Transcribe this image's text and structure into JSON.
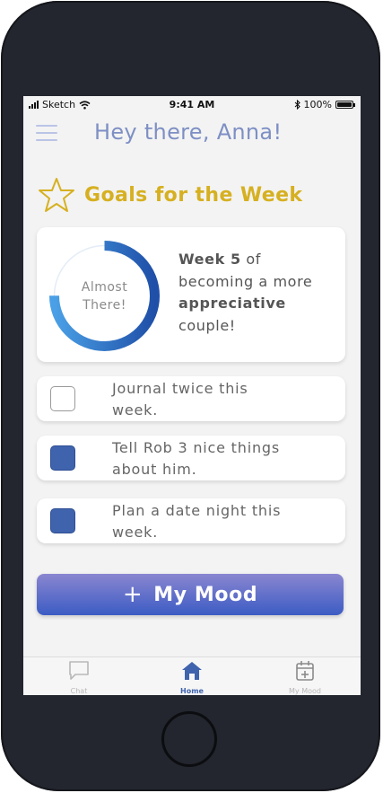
{
  "status_bar": {
    "carrier": "Sketch",
    "time": "9:41 AM",
    "battery": "100%"
  },
  "header": {
    "greeting": "Hey there, Anna!"
  },
  "goals": {
    "title": "Goals for the Week",
    "progress_label_line1": "Almost",
    "progress_label_line2": "There!",
    "progress": 0.75,
    "week_label": "Week 5",
    "text_of": " of",
    "text_becoming": "becoming a more",
    "text_appreciative": "appreciative",
    "text_couple": "couple!"
  },
  "tasks": [
    {
      "line1": "Journal twice this",
      "line2": "week.",
      "checked": false
    },
    {
      "line1": "Tell Rob 3 nice things",
      "line2": "about him.",
      "checked": true
    },
    {
      "line1": "Plan a date night this",
      "line2": "week.",
      "checked": true
    }
  ],
  "mood_button": {
    "plus": "+",
    "label": "My Mood"
  },
  "tabs": [
    {
      "label": "Chat",
      "icon": "chat-bubble-icon",
      "active": false
    },
    {
      "label": "Home",
      "icon": "home-icon",
      "active": true
    },
    {
      "label": "My Mood",
      "icon": "calendar-plus-icon",
      "active": false
    }
  ],
  "colors": {
    "accent_blue": "#3f63ad",
    "greeting": "#7d8fc4",
    "goals_gold": "#d6b021",
    "phone_frame": "#23262e"
  }
}
